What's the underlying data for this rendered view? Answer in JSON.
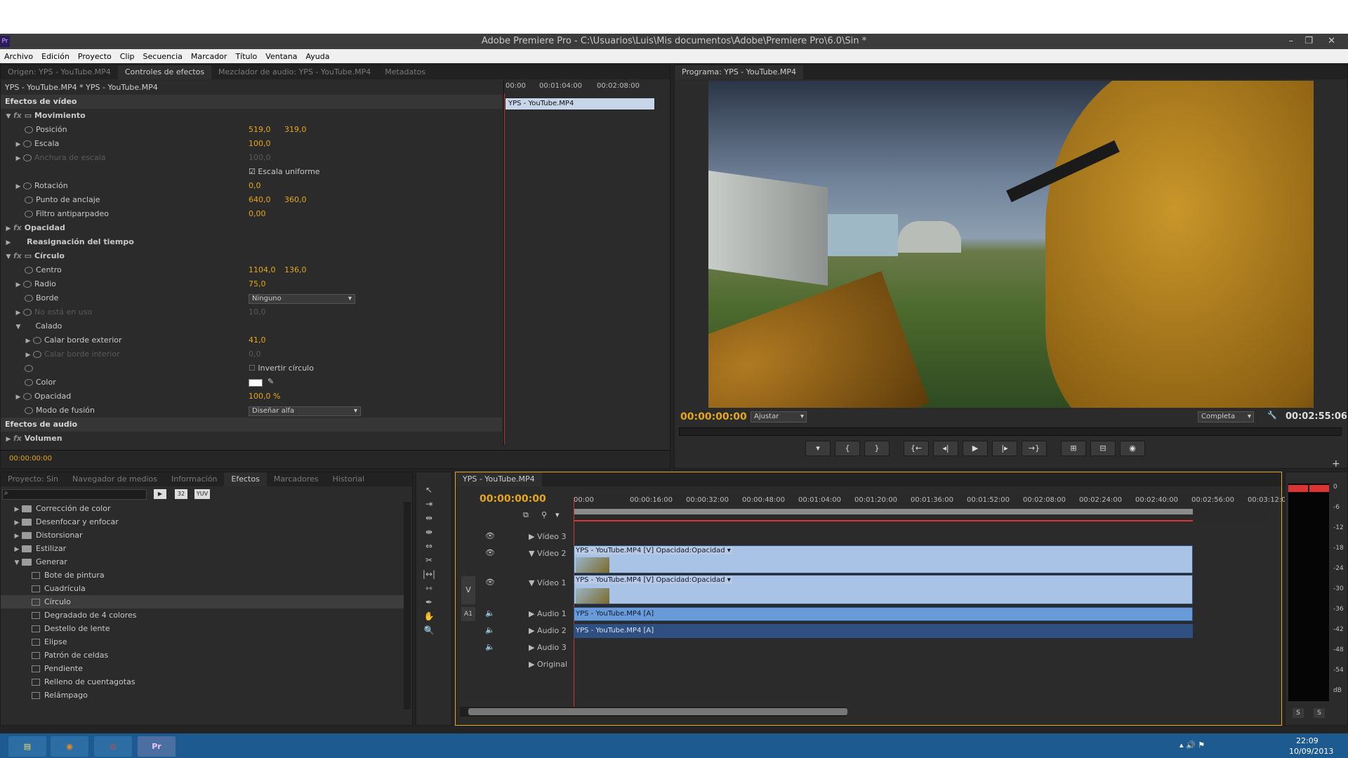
{
  "window": {
    "title": "Adobe Premiere Pro - C:\\Usuarios\\Luis\\Mis documentos\\Adobe\\Premiere Pro\\6.0\\Sin  *",
    "app_icon": "Pr"
  },
  "menu": [
    "Archivo",
    "Edición",
    "Proyecto",
    "Clip",
    "Secuencia",
    "Marcador",
    "Título",
    "Ventana",
    "Ayuda"
  ],
  "source_tabs": [
    "Origen: YPS - YouTube.MP4",
    "Controles de efectos",
    "Mezclador de audio: YPS - YouTube.MP4",
    "Metadatos"
  ],
  "effect_controls": {
    "header": "YPS - YouTube.MP4 * YPS - YouTube.MP4",
    "ruler": [
      "00:00",
      "00:01:04:00",
      "00:02:08:00"
    ],
    "clip_label": "YPS - YouTube.MP4",
    "video_effects": "Efectos de vídeo",
    "motion": "Movimiento",
    "position_label": "Posición",
    "position_x": "519,0",
    "position_y": "319,0",
    "scale_label": "Escala",
    "scale": "100,0",
    "scale_width_label": "Anchura de escala",
    "scale_width": "100,0",
    "uniform_scale": "Escala uniforme",
    "rotation_label": "Rotación",
    "rotation": "0,0",
    "anchor_label": "Punto de anclaje",
    "anchor_x": "640,0",
    "anchor_y": "360,0",
    "flicker_label": "Filtro antiparpadeo",
    "flicker": "0,00",
    "opacity_section": "Opacidad",
    "time_remap": "Reasignación del tiempo",
    "circle": "Círculo",
    "center_label": "Centro",
    "center_x": "1104,0",
    "center_y": "136,0",
    "radius_label": "Radio",
    "radius": "75,0",
    "border_label": "Borde",
    "border_value": "Ninguno",
    "not_used_label": "No está en uso",
    "not_used": "10,0",
    "feather_label": "Calado",
    "feather_outer_label": "Calar borde exterior",
    "feather_outer": "41,0",
    "feather_inner_label": "Calar borde interior",
    "feather_inner": "0,0",
    "invert": "Invertir círculo",
    "color_label": "Color",
    "opacity_label": "Opacidad",
    "opacity": "100,0 %",
    "blend_label": "Modo de fusión",
    "blend_value": "Diseñar alfa",
    "audio_effects": "Efectos de audio",
    "volume": "Volumen",
    "timecode": "00:00:00:00"
  },
  "program": {
    "tab": "Programa: YPS - YouTube.MP4",
    "timecode": "00:00:00:00",
    "fit": "Ajustar",
    "quality": "Completa",
    "duration": "00:02:55:06",
    "transport": [
      "▾",
      "{",
      "}",
      "{←",
      "◂|",
      "▶",
      "|▸",
      "→}",
      "⊞",
      "⊟",
      "◉"
    ]
  },
  "project": {
    "tabs": [
      "Proyecto: Sin",
      "Navegador de medios",
      "Información",
      "Efectos",
      "Marcadores",
      "Historial"
    ],
    "search_placeholder": "",
    "badges": [
      "32",
      "YUV"
    ],
    "items": [
      {
        "kind": "folder",
        "label": "Corrección de color",
        "indent": 1
      },
      {
        "kind": "folder",
        "label": "Desenfocar y enfocar",
        "indent": 1
      },
      {
        "kind": "folder",
        "label": "Distorsionar",
        "indent": 1
      },
      {
        "kind": "folder",
        "label": "Estilizar",
        "indent": 1
      },
      {
        "kind": "folder",
        "label": "Generar",
        "indent": 1,
        "open": true
      },
      {
        "kind": "fx",
        "label": "Bote de pintura",
        "indent": 2
      },
      {
        "kind": "fx",
        "label": "Cuadrícula",
        "indent": 2
      },
      {
        "kind": "fx",
        "label": "Círculo",
        "indent": 2,
        "selected": true
      },
      {
        "kind": "fx",
        "label": "Degradado de 4 colores",
        "indent": 2
      },
      {
        "kind": "fx",
        "label": "Destello de lente",
        "indent": 2
      },
      {
        "kind": "fx",
        "label": "Elipse",
        "indent": 2
      },
      {
        "kind": "fx",
        "label": "Patrón de celdas",
        "indent": 2
      },
      {
        "kind": "fx",
        "label": "Pendiente",
        "indent": 2
      },
      {
        "kind": "fx",
        "label": "Relleno de cuentagotas",
        "indent": 2
      },
      {
        "kind": "fx",
        "label": "Relámpago",
        "indent": 2
      }
    ]
  },
  "timeline": {
    "tab": "YPS - YouTube.MP4",
    "timecode": "00:00:00:00",
    "ruler": [
      "00:00",
      "00:00:16:00",
      "00:00:32:00",
      "00:00:48:00",
      "00:01:04:00",
      "00:01:20:00",
      "00:01:36:00",
      "00:01:52:00",
      "00:02:08:00",
      "00:02:24:00",
      "00:02:40:00",
      "00:02:56:00",
      "00:03:12:0"
    ],
    "tracks": [
      "Vídeo 3",
      "Vídeo 2",
      "Vídeo 1",
      "Audio 1",
      "Audio 2",
      "Audio 3",
      "Original"
    ],
    "v_label": "V",
    "a_label": "A1",
    "clip_v2": "YPS - YouTube.MP4 [V]  Opacidad:Opacidad ▾",
    "clip_v1": "YPS - YouTube.MP4 [V]  Opacidad:Opacidad ▾",
    "clip_a1": "YPS - YouTube.MP4 [A]",
    "clip_a2": "YPS - YouTube.MP4 [A]"
  },
  "meter": {
    "scale": [
      "0",
      "-6",
      "-12",
      "-18",
      "-24",
      "-30",
      "-36",
      "-42",
      "-48",
      "-54",
      "dB"
    ],
    "solo": [
      "S",
      "S"
    ]
  },
  "taskbar": {
    "time": "22:09",
    "date": "10/09/2013"
  },
  "colors": {
    "accent": "#e5a71c",
    "clip_video": "#a9c3e6",
    "clip_audio": "#6a9bd9",
    "taskbar": "#1d5a8f"
  }
}
